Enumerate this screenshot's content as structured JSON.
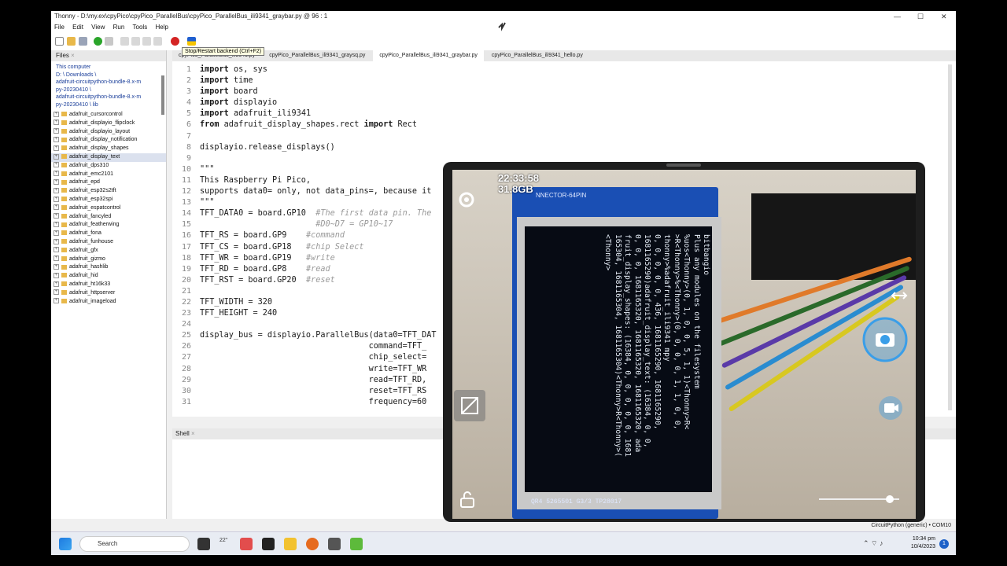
{
  "window": {
    "title": "Thonny  -  D:\\my.ex\\cpyPico\\cpyPico_ParallelBus\\cpyPico_ParallelBus_ili9341_graybar.py  @  96 : 1",
    "minimize": "—",
    "maximize": "☐",
    "close": "✕"
  },
  "menu": [
    "File",
    "Edit",
    "View",
    "Run",
    "Tools",
    "Help"
  ],
  "toolbar": {
    "tooltip": "Stop/Restart backend (Ctrl+F2)"
  },
  "files": {
    "tab_label": "Files",
    "path": [
      "This computer",
      "D: \\ Downloads \\",
      "adafruit-circuitpython-bundle-8.x-m",
      "py-20230410 \\",
      "adafruit-circuitpython-bundle-8.x-m",
      "py-20230410 \\ lib"
    ],
    "items": [
      "adafruit_cursorcontrol",
      "adafruit_displayio_flipclock",
      "adafruit_displayio_layout",
      "adafruit_display_notification",
      "adafruit_display_shapes",
      "adafruit_display_text",
      "adafruit_dps310",
      "adafruit_emc2101",
      "adafruit_epd",
      "adafruit_esp32s2tft",
      "adafruit_esp32spi",
      "adafruit_espatcontrol",
      "adafruit_fancyled",
      "adafruit_featherwing",
      "adafruit_fona",
      "adafruit_funhouse",
      "adafruit_gfx",
      "adafruit_gizmo",
      "adafruit_hashlib",
      "adafruit_hid",
      "adafruit_ht16k33",
      "adafruit_httpserver",
      "adafruit_imageload"
    ]
  },
  "editor": {
    "tabs": [
      "cpyPico_ParallelBus_ili9341.py",
      "cpyPico_ParallelBus_ili9341_graysq.py",
      "cpyPico_ParallelBus_ili9341_graybar.py",
      "cpyPico_ParallelBus_ili9341_hello.py"
    ],
    "lines": [
      "import os, sys",
      "import time",
      "import board",
      "import displayio",
      "import adafruit_ili9341",
      "from adafruit_display_shapes.rect import Rect",
      "",
      "displayio.release_displays()",
      "",
      "\"\"\"",
      "This Raspberry Pi Pico,",
      "supports data0= only, not data_pins=, because it",
      "\"\"\"",
      "TFT_DATA0 = board.GP10  #The first data pin. The",
      "                        #D0~D7 = GP10~17",
      "TFT_RS = board.GP9    #command",
      "TFT_CS = board.GP18   #chip Select",
      "TFT_WR = board.GP19   #write",
      "TFT_RD = board.GP8    #read",
      "TFT_RST = board.GP20  #reset",
      "",
      "TFT_WIDTH = 320",
      "TFT_HEIGHT = 240",
      "",
      "display_bus = displayio.ParallelBus(data0=TFT_DAT",
      "                                   command=TFT_",
      "                                   chip_select=",
      "                                   write=TFT_WR",
      "                                   read=TFT_RD,",
      "                                   reset=TFT_RS",
      "                                   frequency=60"
    ]
  },
  "shell": {
    "tab_label": "Shell"
  },
  "statusbar": {
    "text": "CircuitPython (generic)  •  COM10"
  },
  "taskbar": {
    "search_placeholder": "Search",
    "weather": "22°",
    "time": "10:34 pm",
    "date": "10/4/2023",
    "notification_count": "1"
  },
  "camera": {
    "time": "22:33:58",
    "memory": "31.8GB",
    "header_label": "NNECTOR-64PIN",
    "pcb_label": "QR4  5265501  G3/3       TP28017",
    "zoom_level": 0.88,
    "lcd_lines": [
      "Done | 8.0.5",
      "usb_midi        json        sharpdisplay",
      "audiomp3        keypad      storage",
      "audiocore                   struct",
      "vectorio        math        supervisor",
      "binascii",
      "watchdog        microcontroller",
      "bitbangio",
      "Plus any modules on the filesystem",
      "%uos<Thonny>(0, 1, 0, 0, 5, 1, 1)<Thonny>R<",
      ">R<Thonny>%<Thonny>(0, 0, 0, 0, 1, 1, 0, 0,",
      "thonny>%adafruit_ili9341 mpy",
      "0, 0, 0, 0, 0, 436, 1681165290, 1681165290,",
      "1681165290)adafruit_display_text: (16384, 0, 0,",
      "0, 0, 0, 1681165320, 1681165320, 1681165320, ada",
      "fruit_display_shapes: (16384, 0, 0, 0, 0, 0, 1681",
      "165304, 1681165304, 1681165304)<Thonny>R<Thonny>(",
      "<Thonny>"
    ]
  },
  "colors": {
    "accent": "#1a3e9a",
    "keyword": "#1a1a1a",
    "comment": "#9a9a9a"
  }
}
